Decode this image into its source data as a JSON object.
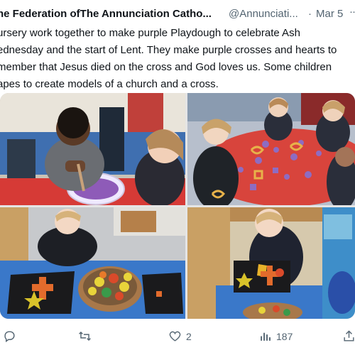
{
  "tweet": {
    "author": "he Federation ofThe Annunciation Catho...",
    "handle": "@Annunciati...",
    "separator": "·",
    "date": "Mar 5",
    "more": "···",
    "text": "ursery work together to make purple Playdough to celebrate Ash\nednesday and the start of Lent. They make purple crosses and hearts to\nmember that Jesus died on the cross and God loves us. Some children\napes to create models of a church and a cross."
  },
  "actions": {
    "reply": {
      "icon": "reply-icon",
      "count": ""
    },
    "retweet": {
      "icon": "retweet-icon",
      "count": ""
    },
    "like": {
      "icon": "heart-icon",
      "count": "2"
    },
    "views": {
      "icon": "views-icon",
      "count": "187"
    },
    "share": {
      "icon": "share-icon",
      "count": ""
    }
  },
  "media": {
    "photos": [
      {
        "icon": "photo-child-mixing-playdough"
      },
      {
        "icon": "photo-children-at-red-table"
      },
      {
        "icon": "photo-child-with-shapes-basket"
      },
      {
        "icon": "photo-child-building-church-model"
      }
    ]
  },
  "colors": {
    "text": "#0f1419",
    "secondary": "#536471",
    "playdough_purple": "#8e5bb8",
    "table_red": "#d8443c"
  }
}
